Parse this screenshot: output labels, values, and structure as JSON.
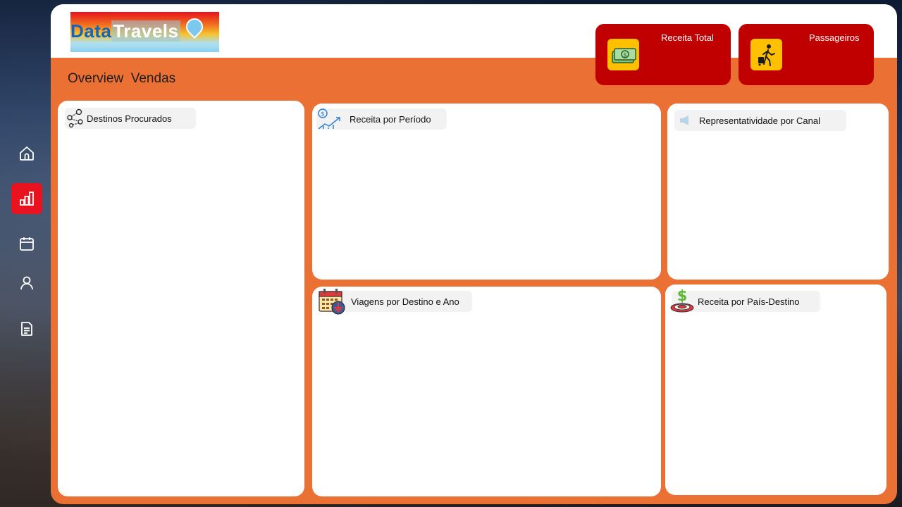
{
  "app": {
    "logo_part1": "Data",
    "logo_part2": "Travels"
  },
  "colors": {
    "accent": "#ea7133",
    "kpi_bg": "#c00000",
    "kpi_icon_bg": "#ffc000",
    "nav_active": "#e8131e"
  },
  "sidebar": {
    "items": [
      {
        "icon": "home-icon",
        "active": false
      },
      {
        "icon": "bar-chart-icon",
        "active": true
      },
      {
        "icon": "calendar-icon",
        "active": false
      },
      {
        "icon": "user-icon",
        "active": false
      },
      {
        "icon": "document-icon",
        "active": false
      }
    ]
  },
  "header": {
    "title": "Overview  Vendas"
  },
  "kpis": [
    {
      "label": "Receita Total",
      "icon": "money-icon"
    },
    {
      "label": "Passageiros",
      "icon": "traveler-icon"
    }
  ],
  "cards": {
    "destinos": {
      "title": "Destinos Procurados",
      "icon": "map-pins-icon"
    },
    "receita_periodo": {
      "title": "Receita por Período",
      "icon": "revenue-growth-icon"
    },
    "canal": {
      "title": "Representatividade por Canal",
      "icon": "megaphone-icon"
    },
    "viagens": {
      "title": "Viagens por Destino e Ano",
      "icon": "calendar-flight-icon"
    },
    "pais": {
      "title": "Receita por País-Destino",
      "icon": "target-money-icon"
    }
  }
}
